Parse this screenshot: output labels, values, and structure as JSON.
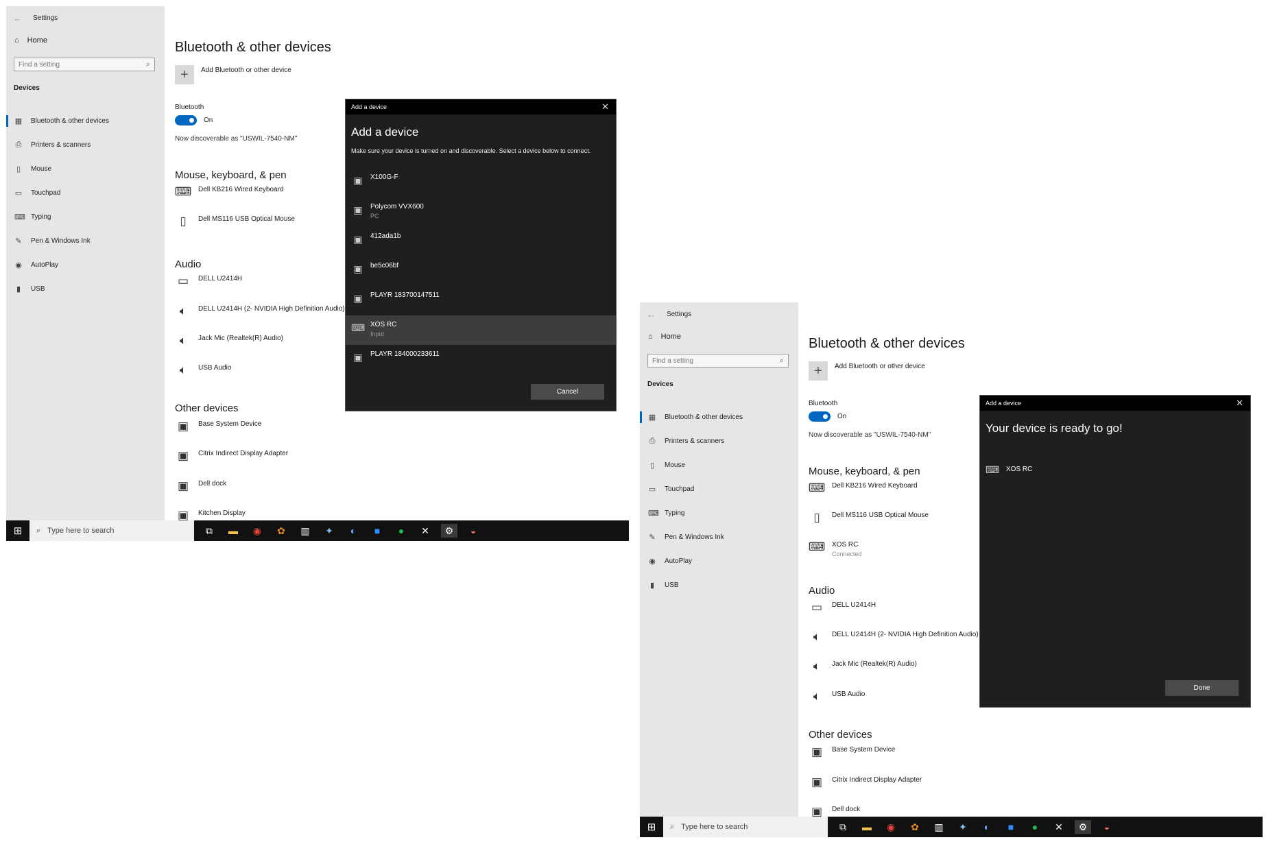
{
  "common": {
    "window_title": "Settings",
    "home_label": "Home",
    "search_placeholder": "Find a setting",
    "section_label": "Devices",
    "nav_items": [
      "Bluetooth & other devices",
      "Printers & scanners",
      "Mouse",
      "Touchpad",
      "Typing",
      "Pen & Windows Ink",
      "AutoPlay",
      "USB"
    ],
    "page_title": "Bluetooth & other devices",
    "add_device_label": "Add Bluetooth or other device",
    "bluetooth_label": "Bluetooth",
    "toggle_state": "On",
    "discoverable_text": "Now discoverable as \"USWIL-7540-NM\"",
    "mouse_section": "Mouse, keyboard, & pen",
    "audio_section": "Audio",
    "other_section": "Other devices",
    "taskbar_search": "Type here to search",
    "accent_color": "#0067c0"
  },
  "shot1": {
    "mouse_devices": [
      {
        "name": "Dell KB216 Wired Keyboard",
        "icon": "keyboard-icon"
      },
      {
        "name": "Dell MS116 USB Optical Mouse",
        "icon": "mouse-icon"
      }
    ],
    "audio_devices": [
      {
        "name": "DELL U2414H",
        "icon": "monitor-icon"
      },
      {
        "name": "DELL U2414H (2- NVIDIA High Definition Audio)",
        "icon": "speaker-icon"
      },
      {
        "name": "Jack Mic (Realtek(R) Audio)",
        "icon": "speaker-icon"
      },
      {
        "name": "USB Audio",
        "icon": "speaker-icon"
      }
    ],
    "other_devices": [
      {
        "name": "Base System Device",
        "icon": "device-icon"
      },
      {
        "name": "Citrix Indirect Display Adapter",
        "icon": "device-icon"
      },
      {
        "name": "Dell dock",
        "icon": "device-icon"
      },
      {
        "name": "Kitchen Display",
        "icon": "device-icon"
      }
    ],
    "dialog": {
      "window_title": "Add a device",
      "title": "Add a device",
      "description": "Make sure your device is turned on and discoverable. Select a device below to connect.",
      "devices": [
        {
          "name": "X100G-F",
          "sub": ""
        },
        {
          "name": "Polycom VVX600",
          "sub": "PC"
        },
        {
          "name": "412ada1b",
          "sub": ""
        },
        {
          "name": "be5c06bf",
          "sub": ""
        },
        {
          "name": "PLAYR 183700147511",
          "sub": ""
        },
        {
          "name": "XOS RC",
          "sub": "Input"
        },
        {
          "name": "PLAYR 184000233611",
          "sub": ""
        }
      ],
      "cancel_label": "Cancel"
    }
  },
  "shot2": {
    "mouse_devices": [
      {
        "name": "Dell KB216 Wired Keyboard",
        "icon": "keyboard-icon",
        "sub": ""
      },
      {
        "name": "Dell MS116 USB Optical Mouse",
        "icon": "mouse-icon",
        "sub": ""
      },
      {
        "name": "XOS RC",
        "icon": "keyboard-icon",
        "sub": "Connected"
      }
    ],
    "audio_devices": [
      {
        "name": "DELL U2414H",
        "icon": "monitor-icon"
      },
      {
        "name": "DELL U2414H (2- NVIDIA High Definition Audio)",
        "icon": "speaker-icon"
      },
      {
        "name": "Jack Mic (Realtek(R) Audio)",
        "icon": "speaker-icon"
      },
      {
        "name": "USB Audio",
        "icon": "speaker-icon"
      }
    ],
    "other_devices": [
      {
        "name": "Base System Device",
        "icon": "device-icon"
      },
      {
        "name": "Citrix Indirect Display Adapter",
        "icon": "device-icon"
      },
      {
        "name": "Dell dock",
        "icon": "device-icon"
      }
    ],
    "dialog": {
      "window_title": "Add a device",
      "title": "Your device is ready to go!",
      "device": "XOS RC",
      "done_label": "Done"
    }
  }
}
